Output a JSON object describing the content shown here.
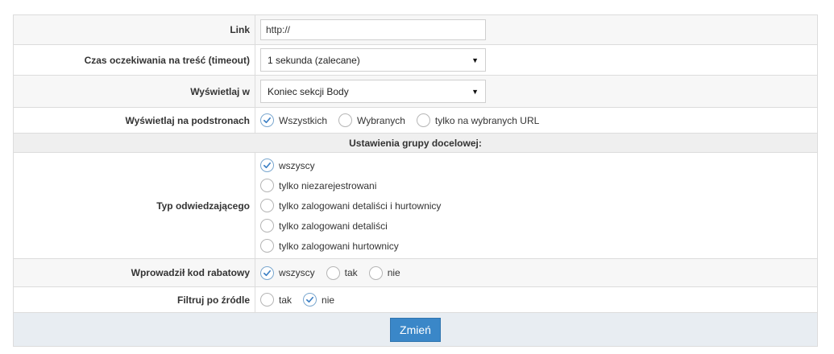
{
  "link": {
    "label": "Link",
    "value": "http://"
  },
  "timeout": {
    "label": "Czas oczekiwania na treść (timeout)",
    "selected": "1 sekunda (zalecane)"
  },
  "display_in": {
    "label": "Wyświetlaj w",
    "selected": "Koniec sekcji Body"
  },
  "subpages": {
    "label": "Wyświetlaj na podstronach",
    "options": [
      "Wszystkich",
      "Wybranych",
      "tylko na wybranych URL"
    ],
    "checked_index": 0
  },
  "target_group": {
    "heading": "Ustawienia grupy docelowej:"
  },
  "visitor_type": {
    "label": "Typ odwiedzającego",
    "options": [
      "wszyscy",
      "tylko niezarejestrowani",
      "tylko zalogowani detaliści i hurtownicy",
      "tylko zalogowani detaliści",
      "tylko zalogowani hurtownicy"
    ],
    "checked_index": 0
  },
  "discount_code": {
    "label": "Wprowadził kod rabatowy",
    "options": [
      "wszyscy",
      "tak",
      "nie"
    ],
    "checked_index": 0
  },
  "source_filter": {
    "label": "Filtruj po źródle",
    "options": [
      "tak",
      "nie"
    ],
    "checked_index": 1
  },
  "submit": {
    "label": "Zmień"
  },
  "colors": {
    "accent": "#3a87c8",
    "check": "#3b7fc4"
  },
  "icons": {
    "dropdown": "triangle-down",
    "radio_checked": "check-mark"
  }
}
